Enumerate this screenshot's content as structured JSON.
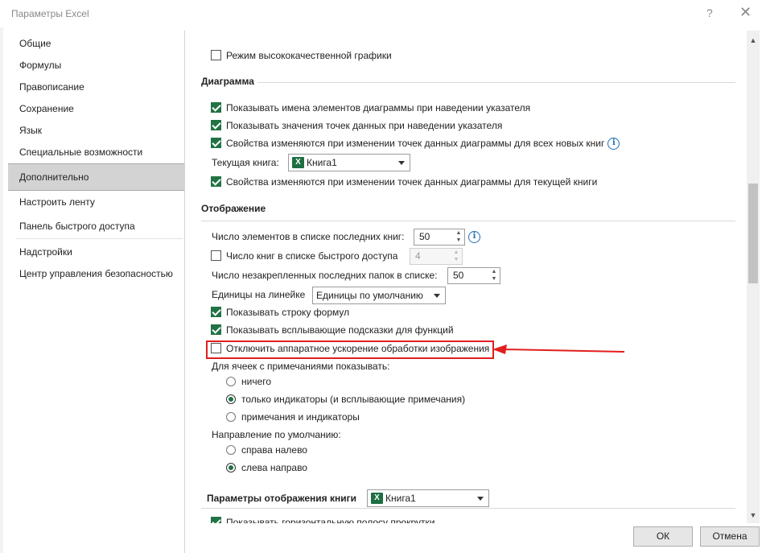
{
  "window": {
    "title": "Параметры Excel",
    "help_icon": "?",
    "close_icon": "✕"
  },
  "sidebar": {
    "items": [
      {
        "label": "Общие"
      },
      {
        "label": "Формулы"
      },
      {
        "label": "Правописание"
      },
      {
        "label": "Сохранение"
      },
      {
        "label": "Язык"
      },
      {
        "label": "Специальные возможности"
      },
      {
        "label": "Дополнительно",
        "active": true
      },
      {
        "label": "Настроить ленту"
      },
      {
        "label": "Панель быстрого доступа"
      },
      {
        "label": "Надстройки"
      },
      {
        "label": "Центр управления безопасностью"
      }
    ]
  },
  "content": {
    "hq_graphics": {
      "label": "Режим высококачественной графики",
      "checked": false
    },
    "chart": {
      "header": "Диаграмма",
      "show_names": {
        "label": "Показывать имена элементов диаграммы при наведении указателя",
        "checked": true
      },
      "show_values": {
        "label": "Показывать значения точек данных при наведении указателя",
        "checked": true
      },
      "props_all": {
        "label": "Свойства изменяются при изменении точек данных диаграммы для всех новых книг",
        "checked": true
      },
      "current_book_label": "Текущая книга:",
      "current_book_value": "Книга1",
      "props_current": {
        "label": "Свойства изменяются при изменении точек данных диаграммы для текущей книги",
        "checked": true
      }
    },
    "display": {
      "header": "Отображение",
      "recent_books_label": "Число элементов в списке последних книг:",
      "recent_books_value": "50",
      "quick_access": {
        "label": "Число книг в списке быстрого доступа",
        "checked": false,
        "value": "4"
      },
      "recent_folders_label": "Число незакрепленных последних папок в списке:",
      "recent_folders_value": "50",
      "ruler_units_label": "Единицы на линейке",
      "ruler_units_value": "Единицы по умолчанию",
      "formula_bar": {
        "label": "Показывать строку формул",
        "checked": true
      },
      "func_tooltips": {
        "label": "Показывать всплывающие подсказки для функций",
        "checked": true
      },
      "hw_accel": {
        "label": "Отключить аппаратное ускорение обработки изображения",
        "checked": false
      },
      "comments_label": "Для ячеек с примечаниями показывать:",
      "comments_options": [
        {
          "label": "ничего",
          "checked": false
        },
        {
          "label": "только индикаторы (и всплывающие примечания)",
          "checked": true
        },
        {
          "label": "примечания и индикаторы",
          "checked": false
        }
      ],
      "direction_label": "Направление по умолчанию:",
      "direction_options": [
        {
          "label": "справа налево",
          "checked": false
        },
        {
          "label": "слева направо",
          "checked": true
        }
      ]
    },
    "book_display": {
      "header": "Параметры отображения книги",
      "book_value": "Книга1",
      "hscroll": {
        "label": "Показывать горизонтальную полосу прокрутки",
        "checked": true
      }
    }
  },
  "buttons": {
    "ok": "ОК",
    "cancel": "Отмена"
  },
  "colors": {
    "accent": "#217346",
    "highlight": "#e21e1e",
    "info": "#1f6fb5"
  },
  "icons": {
    "excel_book": "X"
  }
}
